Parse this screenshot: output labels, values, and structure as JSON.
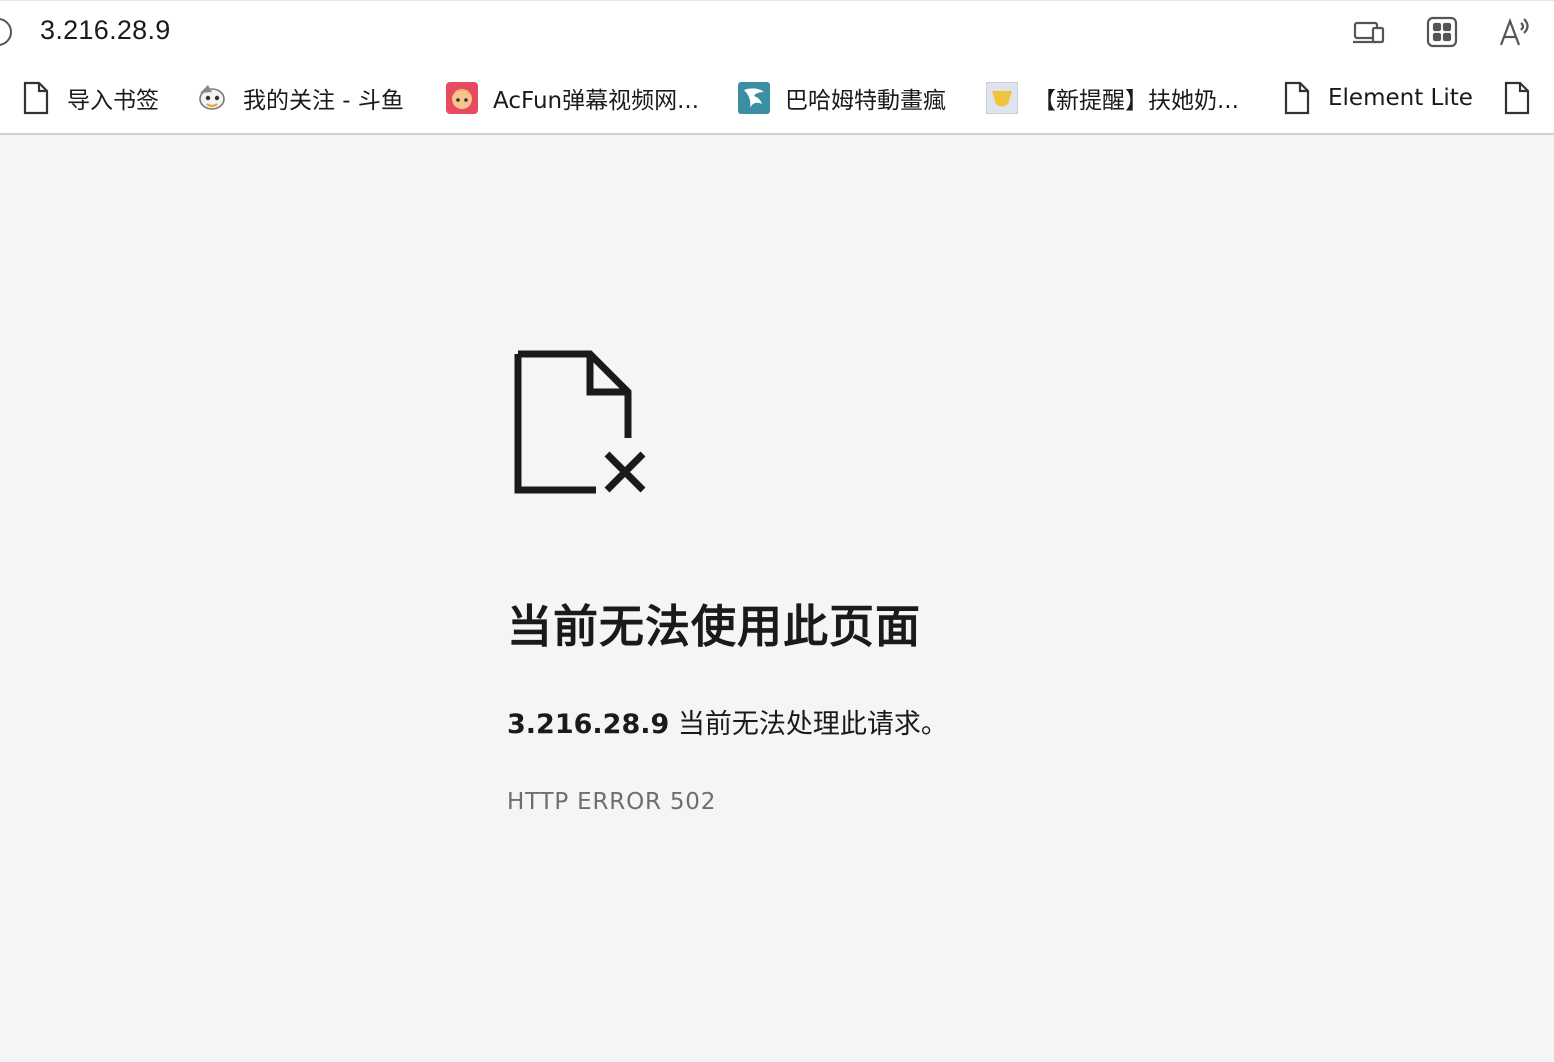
{
  "address_bar": {
    "url": "3.216.28.9"
  },
  "toolbar": {
    "icons": [
      "devices-icon",
      "apps-grid-icon",
      "read-aloud-icon"
    ]
  },
  "bookmarks": [
    {
      "label": "导入书签",
      "icon": "file-icon"
    },
    {
      "label": "我的关注 - 斗鱼",
      "icon": "douyu-favicon"
    },
    {
      "label": "AcFun弹幕视频网...",
      "icon": "acfun-favicon"
    },
    {
      "label": "巴哈姆特動畫瘋",
      "icon": "bahamut-favicon"
    },
    {
      "label": "【新提醒】扶她奶...",
      "icon": "yellow-favicon"
    },
    {
      "label": "Element Lite",
      "icon": "file-icon"
    },
    {
      "label": "",
      "icon": "file-icon"
    }
  ],
  "error": {
    "icon": "broken-file-icon",
    "title": "当前无法使用此页面",
    "host": "3.216.28.9",
    "message": " 当前无法处理此请求。",
    "code": "HTTP ERROR 502"
  },
  "colors": {
    "page_bg": "#f5f5f5",
    "text": "#1a1a1a",
    "muted": "#6e6e6e",
    "acfun": "#e84a5f",
    "bahamut": "#3a8fa3",
    "folder_yellow": "#f0c33c"
  }
}
